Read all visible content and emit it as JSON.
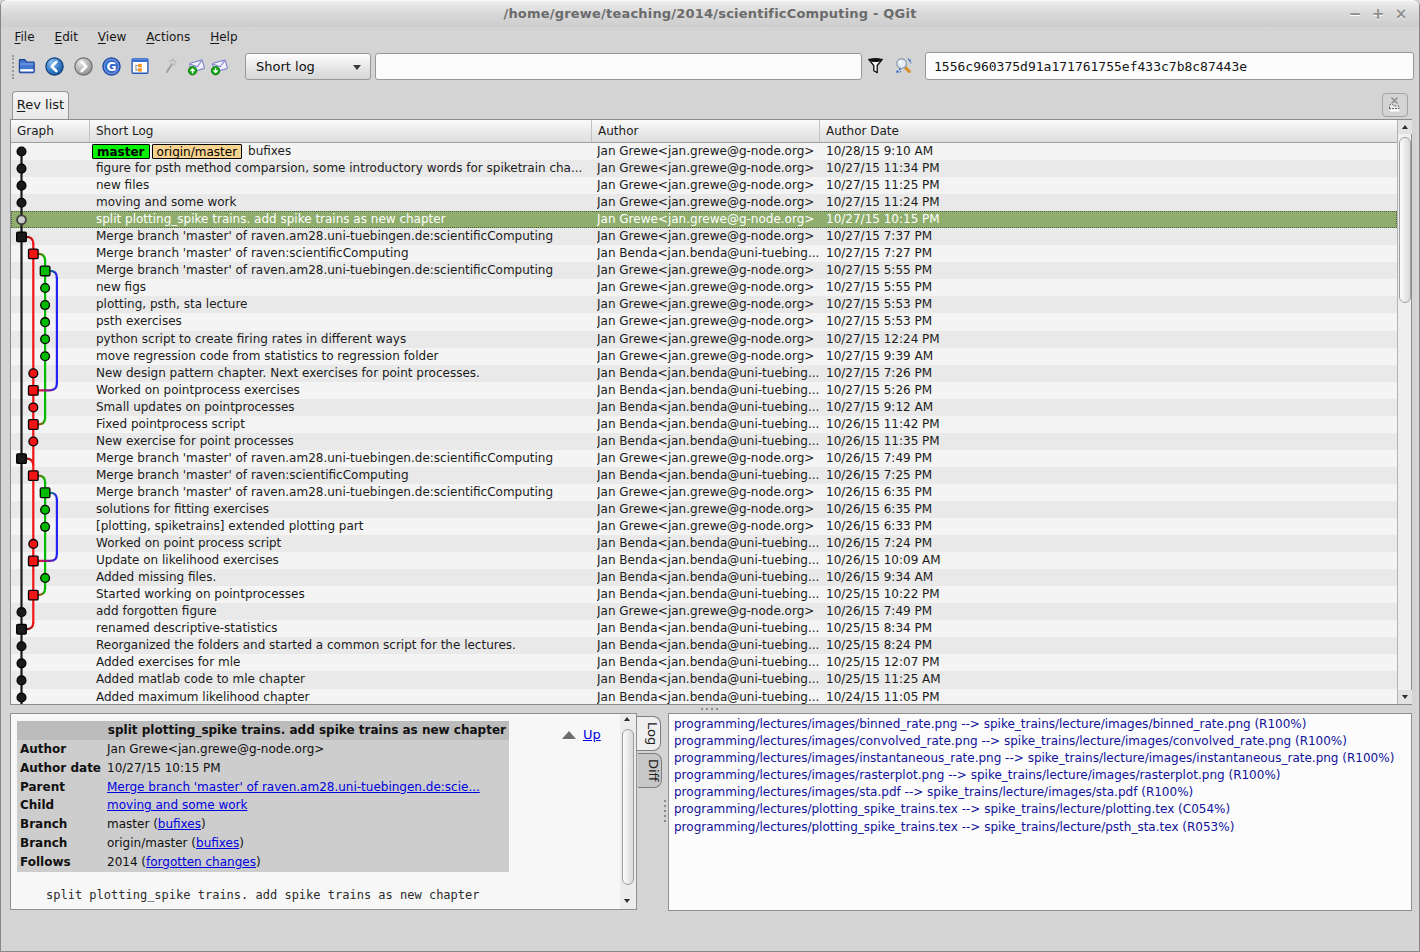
{
  "window": {
    "title": "/home/grewe/teaching/2014/scientificComputing - QGit",
    "controls": {
      "minimize": "−",
      "maximize": "+",
      "close": "×"
    }
  },
  "menu": {
    "items": [
      {
        "mn": "F",
        "rest": "ile"
      },
      {
        "mn": "E",
        "rest": "dit"
      },
      {
        "mn": "V",
        "rest": "iew"
      },
      {
        "mn": "A",
        "rest": "ctions"
      },
      {
        "mn": "H",
        "rest": "elp"
      }
    ]
  },
  "toolbar": {
    "icons": [
      "open-repository",
      "back",
      "forward",
      "refresh",
      "tree-view",
      "wand",
      "save-patch",
      "apply-patch",
      "filter",
      "highlight-search"
    ],
    "view_mode": "Short log",
    "filter_value": "",
    "filter_placeholder": "",
    "sha": "1556c960375d91a171761755ef433c7b8c87443e"
  },
  "tabs": {
    "rev_list": {
      "mn": "R",
      "rest": "ev list"
    }
  },
  "revtable": {
    "columns": [
      "Graph",
      "Short Log",
      "Author",
      "Author Date"
    ],
    "selected_index": 4,
    "authors": {
      "grewe": "Jan Grewe<jan.grewe@g-node.org>",
      "benda": "Jan Benda<jan.benda@uni-tuebing..."
    },
    "rows": [
      {
        "log": "bufixes",
        "author": "Jan Grewe<jan.grewe@g-node.org>",
        "date": "10/28/15 9:10 AM",
        "tags": [
          {
            "text": "master",
            "color": "green"
          },
          {
            "text": "origin/master",
            "color": "tan"
          }
        ]
      },
      {
        "log": "figure for psth method comparsion, some introductory words for spiketrain cha...",
        "author": "Jan Grewe<jan.grewe@g-node.org>",
        "date": "10/27/15 11:34 PM"
      },
      {
        "log": "new files",
        "author": "Jan Grewe<jan.grewe@g-node.org>",
        "date": "10/27/15 11:25 PM"
      },
      {
        "log": "moving and some work",
        "author": "Jan Grewe<jan.grewe@g-node.org>",
        "date": "10/27/15 11:24 PM"
      },
      {
        "log": "split plotting_spike trains. add spike trains as new chapter",
        "author": "Jan Grewe<jan.grewe@g-node.org>",
        "date": "10/27/15 10:15 PM",
        "selected": true
      },
      {
        "log": "Merge branch 'master' of raven.am28.uni-tuebingen.de:scientificComputing",
        "author": "Jan Grewe<jan.grewe@g-node.org>",
        "date": "10/27/15 7:37 PM"
      },
      {
        "log": "Merge branch 'master' of raven:scientificComputing",
        "author": "Jan Benda<jan.benda@uni-tuebing...",
        "date": "10/27/15 7:27 PM"
      },
      {
        "log": "Merge branch 'master' of raven.am28.uni-tuebingen.de:scientificComputing",
        "author": "Jan Grewe<jan.grewe@g-node.org>",
        "date": "10/27/15 5:55 PM"
      },
      {
        "log": "new figs",
        "author": "Jan Grewe<jan.grewe@g-node.org>",
        "date": "10/27/15 5:55 PM"
      },
      {
        "log": "plotting, psth, sta lecture",
        "author": "Jan Grewe<jan.grewe@g-node.org>",
        "date": "10/27/15 5:53 PM"
      },
      {
        "log": "psth exercises",
        "author": "Jan Grewe<jan.grewe@g-node.org>",
        "date": "10/27/15 5:53 PM"
      },
      {
        "log": "python script to create firing rates in different ways",
        "author": "Jan Grewe<jan.grewe@g-node.org>",
        "date": "10/27/15 12:24 PM"
      },
      {
        "log": "move regression code from statistics to regression folder",
        "author": "Jan Grewe<jan.grewe@g-node.org>",
        "date": "10/27/15 9:39 AM"
      },
      {
        "log": "New design pattern chapter. Next exercises for point processes.",
        "author": "Jan Benda<jan.benda@uni-tuebing...",
        "date": "10/27/15 7:26 PM"
      },
      {
        "log": "Worked on pointprocess exercises",
        "author": "Jan Benda<jan.benda@uni-tuebing...",
        "date": "10/27/15 5:26 PM"
      },
      {
        "log": "Small updates on pointprocesses",
        "author": "Jan Benda<jan.benda@uni-tuebing...",
        "date": "10/27/15 9:12 AM"
      },
      {
        "log": "Fixed pointprocess script",
        "author": "Jan Benda<jan.benda@uni-tuebing...",
        "date": "10/26/15 11:42 PM"
      },
      {
        "log": "New exercise for point processes",
        "author": "Jan Benda<jan.benda@uni-tuebing...",
        "date": "10/26/15 11:35 PM"
      },
      {
        "log": "Merge branch 'master' of raven.am28.uni-tuebingen.de:scientificComputing",
        "author": "Jan Grewe<jan.grewe@g-node.org>",
        "date": "10/26/15 7:49 PM"
      },
      {
        "log": "Merge branch 'master' of raven:scientificComputing",
        "author": "Jan Benda<jan.benda@uni-tuebing...",
        "date": "10/26/15 7:25 PM"
      },
      {
        "log": "Merge branch 'master' of raven.am28.uni-tuebingen.de:scientificComputing",
        "author": "Jan Grewe<jan.grewe@g-node.org>",
        "date": "10/26/15 6:35 PM"
      },
      {
        "log": "solutions for fitting exercises",
        "author": "Jan Grewe<jan.grewe@g-node.org>",
        "date": "10/26/15 6:35 PM"
      },
      {
        "log": "[plotting, spiketrains] extended plotting part",
        "author": "Jan Grewe<jan.grewe@g-node.org>",
        "date": "10/26/15 6:33 PM"
      },
      {
        "log": "Worked on point process script",
        "author": "Jan Benda<jan.benda@uni-tuebing...",
        "date": "10/26/15 7:24 PM"
      },
      {
        "log": "Update on likelihood exercises",
        "author": "Jan Benda<jan.benda@uni-tuebing...",
        "date": "10/26/15 10:09 AM"
      },
      {
        "log": "Added missing files.",
        "author": "Jan Benda<jan.benda@uni-tuebing...",
        "date": "10/26/15 9:34 AM"
      },
      {
        "log": "Started working on pointprocesses",
        "author": "Jan Benda<jan.benda@uni-tuebing...",
        "date": "10/25/15 10:22 PM"
      },
      {
        "log": "add forgotten figure",
        "author": "Jan Grewe<jan.grewe@g-node.org>",
        "date": "10/26/15 7:49 PM"
      },
      {
        "log": "renamed descriptive-statistics",
        "author": "Jan Benda<jan.benda@uni-tuebing...",
        "date": "10/25/15 8:34 PM"
      },
      {
        "log": "Reorganized the folders and started a common script for the lectures.",
        "author": "Jan Benda<jan.benda@uni-tuebing...",
        "date": "10/25/15 8:24 PM"
      },
      {
        "log": "Added exercises for mle",
        "author": "Jan Benda<jan.benda@uni-tuebing...",
        "date": "10/25/15 12:07 PM"
      },
      {
        "log": "Added matlab code to mle chapter",
        "author": "Jan Benda<jan.benda@uni-tuebing...",
        "date": "10/25/15 11:25 AM"
      },
      {
        "log": "Added maximum likelihood chapter",
        "author": "Jan Benda<jan.benda@uni-tuebing...",
        "date": "10/24/15 11:05 PM"
      }
    ]
  },
  "graph": {
    "colors": {
      "black": "#1a1a1a",
      "red": "#f01414",
      "green": "#00bb00",
      "blue": "#2222f5",
      "open_fill": "#cccccc",
      "open_stroke": "#3c3c3c"
    },
    "lanes_x": [
      10.5,
      22.3,
      34.1,
      45.9
    ],
    "row_height": 17.06,
    "nodes": [
      {
        "row": 0,
        "lane": 0,
        "shape": "circle",
        "color": "black"
      },
      {
        "row": 1,
        "lane": 0,
        "shape": "circle",
        "color": "black"
      },
      {
        "row": 2,
        "lane": 0,
        "shape": "circle",
        "color": "black"
      },
      {
        "row": 3,
        "lane": 0,
        "shape": "circle",
        "color": "black"
      },
      {
        "row": 4,
        "lane": 0,
        "shape": "open",
        "color": "black"
      },
      {
        "row": 5,
        "lane": 0,
        "shape": "square",
        "color": "black"
      },
      {
        "row": 6,
        "lane": 1,
        "shape": "square",
        "color": "red"
      },
      {
        "row": 7,
        "lane": 2,
        "shape": "square",
        "color": "green"
      },
      {
        "row": 8,
        "lane": 2,
        "shape": "circle",
        "color": "green"
      },
      {
        "row": 9,
        "lane": 2,
        "shape": "circle",
        "color": "green"
      },
      {
        "row": 10,
        "lane": 2,
        "shape": "circle",
        "color": "green"
      },
      {
        "row": 11,
        "lane": 2,
        "shape": "circle",
        "color": "green"
      },
      {
        "row": 12,
        "lane": 2,
        "shape": "circle",
        "color": "green"
      },
      {
        "row": 13,
        "lane": 1,
        "shape": "circle",
        "color": "red"
      },
      {
        "row": 14,
        "lane": 1,
        "shape": "square",
        "color": "red"
      },
      {
        "row": 15,
        "lane": 1,
        "shape": "circle",
        "color": "red"
      },
      {
        "row": 16,
        "lane": 1,
        "shape": "square",
        "color": "red"
      },
      {
        "row": 17,
        "lane": 1,
        "shape": "circle",
        "color": "red"
      },
      {
        "row": 18,
        "lane": 0,
        "shape": "square",
        "color": "black"
      },
      {
        "row": 19,
        "lane": 1,
        "shape": "square",
        "color": "red"
      },
      {
        "row": 20,
        "lane": 2,
        "shape": "square",
        "color": "green"
      },
      {
        "row": 21,
        "lane": 2,
        "shape": "circle",
        "color": "green"
      },
      {
        "row": 22,
        "lane": 2,
        "shape": "circle",
        "color": "green"
      },
      {
        "row": 23,
        "lane": 1,
        "shape": "circle",
        "color": "red"
      },
      {
        "row": 24,
        "lane": 1,
        "shape": "square",
        "color": "red"
      },
      {
        "row": 25,
        "lane": 2,
        "shape": "circle",
        "color": "green"
      },
      {
        "row": 26,
        "lane": 1,
        "shape": "square",
        "color": "red"
      },
      {
        "row": 27,
        "lane": 0,
        "shape": "circle",
        "color": "black"
      },
      {
        "row": 28,
        "lane": 0,
        "shape": "square",
        "color": "black"
      },
      {
        "row": 29,
        "lane": 0,
        "shape": "circle",
        "color": "black"
      },
      {
        "row": 30,
        "lane": 0,
        "shape": "circle",
        "color": "black"
      },
      {
        "row": 31,
        "lane": 0,
        "shape": "circle",
        "color": "black"
      },
      {
        "row": 32,
        "lane": 0,
        "shape": "circle",
        "color": "black"
      }
    ],
    "verticals": [
      {
        "lane": 0,
        "from_row": 0,
        "to": "bottom",
        "color": "black"
      },
      {
        "lane": 1,
        "from_row": 5,
        "to_row": 28,
        "color": "red"
      },
      {
        "lane": 2,
        "from_row": 6,
        "to_row": 16,
        "color": "green"
      },
      {
        "lane": 2,
        "from_row": 19,
        "to_row": 26,
        "color": "green"
      },
      {
        "lane": 3,
        "from_row": 7,
        "to_row": 14,
        "color": "blue"
      },
      {
        "lane": 3,
        "from_row": 20,
        "to_row": 24,
        "color": "blue"
      }
    ],
    "branch_curves": [
      {
        "row": 5,
        "from_lane": 0,
        "to_lane": 1,
        "from_color": "black",
        "to_color": "red"
      },
      {
        "row": 6,
        "from_lane": 1,
        "to_lane": 2,
        "from_color": "red",
        "to_color": "green"
      },
      {
        "row": 7,
        "from_lane": 2,
        "to_lane": 3,
        "from_color": "green",
        "to_color": "blue"
      },
      {
        "row": 18,
        "from_lane": 0,
        "to_lane": 1,
        "from_color": "black",
        "to_color": "red"
      },
      {
        "row": 19,
        "from_lane": 1,
        "to_lane": 2,
        "from_color": "red",
        "to_color": "green"
      },
      {
        "row": 20,
        "from_lane": 2,
        "to_lane": 3,
        "from_color": "green",
        "to_color": "blue"
      }
    ],
    "merge_curves": [
      {
        "row": 14,
        "from_lane": 3,
        "to_lane": 1,
        "from_color": "blue",
        "to_color": "red"
      },
      {
        "row": 16,
        "from_lane": 2,
        "to_lane": 1,
        "from_color": "green",
        "to_color": "red"
      },
      {
        "row": 24,
        "from_lane": 3,
        "to_lane": 1,
        "from_color": "blue",
        "to_color": "red"
      },
      {
        "row": 26,
        "from_lane": 2,
        "to_lane": 1,
        "from_color": "green",
        "to_color": "red"
      },
      {
        "row": 28,
        "from_lane": 1,
        "to_lane": 0,
        "from_color": "red",
        "to_color": "black"
      }
    ]
  },
  "detail": {
    "title": "split plotting_spike trains. add spike trains as new chapter",
    "fields": [
      {
        "label": "Author",
        "parts": [
          {
            "t": "Jan Grewe<jan.grewe@g-node.org>"
          }
        ]
      },
      {
        "label": "Author date",
        "parts": [
          {
            "t": "10/27/15 10:15 PM"
          }
        ]
      },
      {
        "label": "Parent",
        "parts": [
          {
            "t": "Merge branch 'master' of raven.am28.uni-tuebingen.de:scie...",
            "link": true
          }
        ]
      },
      {
        "label": "Child",
        "parts": [
          {
            "t": "moving and some work",
            "link": true
          }
        ]
      },
      {
        "label": "Branch",
        "parts": [
          {
            "t": "master ("
          },
          {
            "t": "bufixes",
            "link": true
          },
          {
            "t": ")"
          }
        ]
      },
      {
        "label": "Branch",
        "parts": [
          {
            "t": "origin/master ("
          },
          {
            "t": "bufixes",
            "link": true
          },
          {
            "t": ")"
          }
        ]
      },
      {
        "label": "Follows",
        "parts": [
          {
            "t": "2014 ("
          },
          {
            "t": "forgotten changes",
            "link": true
          },
          {
            "t": ")"
          }
        ]
      }
    ],
    "up_label": "Up",
    "message": "split plotting_spike trains. add spike trains as new chapter"
  },
  "side_tabs": {
    "log": "Log",
    "diff": "Diff"
  },
  "files_panel": {
    "lines": [
      "programming/lectures/images/binned_rate.png --> spike_trains/lecture/images/binned_rate.png (R100%)",
      "programming/lectures/images/convolved_rate.png --> spike_trains/lecture/images/convolved_rate.png (R100%)",
      "programming/lectures/images/instantaneous_rate.png --> spike_trains/lecture/images/instantaneous_rate.png (R100%)",
      "programming/lectures/images/rasterplot.png --> spike_trains/lecture/images/rasterplot.png (R100%)",
      "programming/lectures/images/sta.pdf --> spike_trains/lecture/images/sta.pdf (R100%)",
      "programming/lectures/plotting_spike_trains.tex --> spike_trains/lecture/plotting.tex (C054%)",
      "programming/lectures/plotting_spike_trains.tex --> spike_trains/lecture/psth_sta.tex (R053%)"
    ]
  }
}
